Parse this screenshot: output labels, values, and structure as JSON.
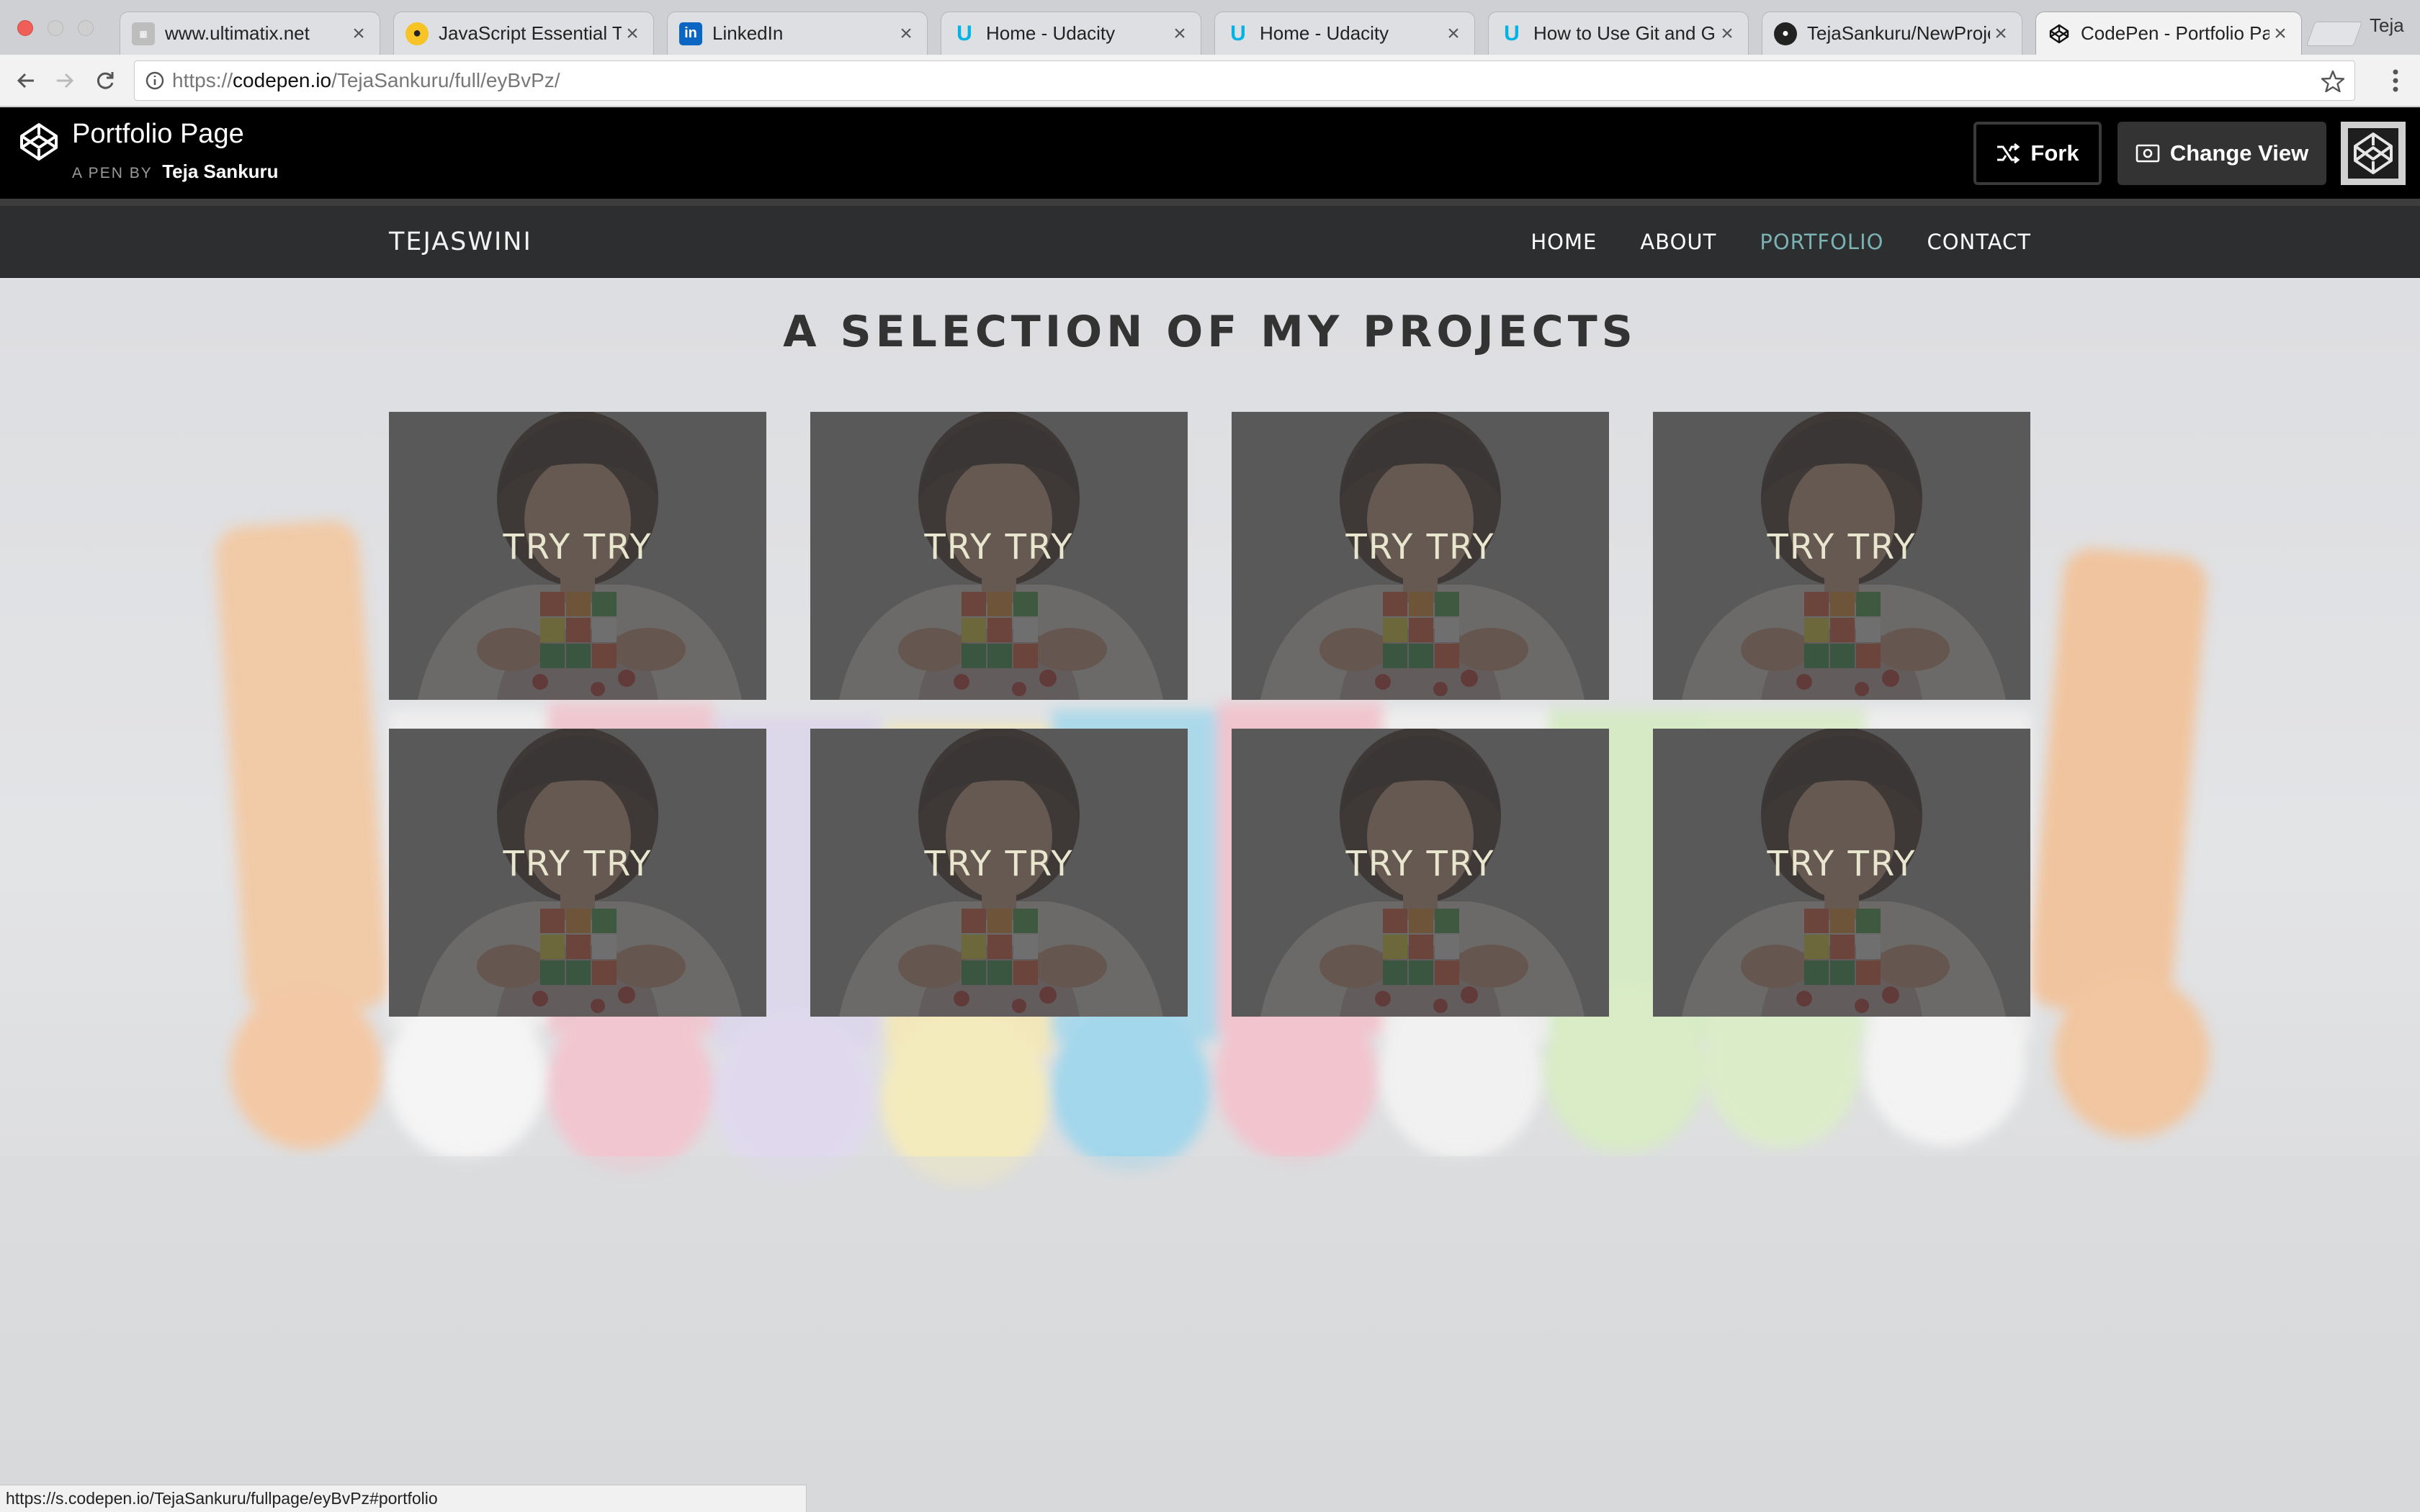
{
  "browser": {
    "tabs": [
      {
        "label": "www.ultimatix.net",
        "icon": "ultimatix-icon"
      },
      {
        "label": "JavaScript Essential Tra",
        "icon": "js-icon"
      },
      {
        "label": "LinkedIn",
        "icon": "linkedin-icon"
      },
      {
        "label": "Home - Udacity",
        "icon": "udacity-icon"
      },
      {
        "label": "Home - Udacity",
        "icon": "udacity-icon"
      },
      {
        "label": "How to Use Git and Gith",
        "icon": "udacity-icon"
      },
      {
        "label": "TejaSankuru/NewProjec",
        "icon": "github-icon"
      },
      {
        "label": "CodePen - Portfolio Pag",
        "icon": "codepen-icon"
      }
    ],
    "profile_name": "Teja",
    "url_prefix": "https://",
    "url_host": "codepen.io",
    "url_path": "/TejaSankuru/full/eyBvPz/",
    "status_url": "https://s.codepen.io/TejaSankuru/fullpage/eyBvPz#portfolio"
  },
  "codepen": {
    "title": "Portfolio Page",
    "byline": "A PEN BY",
    "author": "Teja Sankuru",
    "fork_label": "Fork",
    "change_view_label": "Change View"
  },
  "site": {
    "brand": "TEJASWINI",
    "nav": [
      "HOME",
      "ABOUT",
      "PORTFOLIO",
      "CONTACT"
    ],
    "active_nav": "PORTFOLIO",
    "section_title": "A SELECTION OF MY PROJECTS",
    "projects": [
      {
        "caption": "TRY TRY"
      },
      {
        "caption": "TRY TRY"
      },
      {
        "caption": "TRY TRY"
      },
      {
        "caption": "TRY TRY"
      },
      {
        "caption": "TRY TRY"
      },
      {
        "caption": "TRY TRY"
      },
      {
        "caption": "TRY TRY"
      },
      {
        "caption": "TRY TRY"
      }
    ]
  },
  "colors": {
    "codepen_header": "#000000",
    "site_nav": "#2d2e2f",
    "active_nav": "#7ab2b3",
    "caption": "#e8e6cf"
  }
}
